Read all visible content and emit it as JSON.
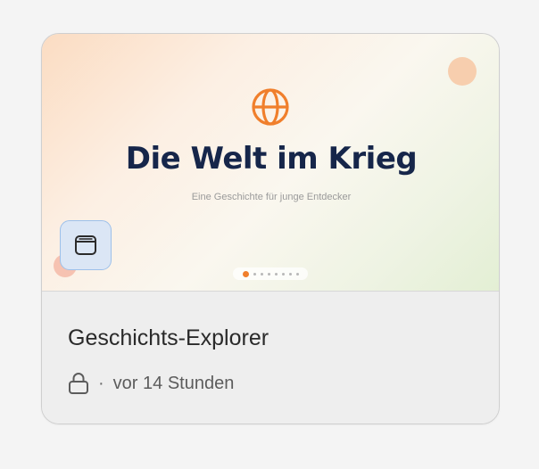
{
  "preview": {
    "title": "Die Welt im Krieg",
    "subtitle": "Eine Geschichte für junge Entdecker",
    "icon": "globe-icon",
    "app_icon": "browser-window-icon",
    "carousel": {
      "total": 8,
      "active_index": 0
    }
  },
  "project": {
    "name": "Geschichts-Explorer",
    "visibility_icon": "lock-icon",
    "separator": "·",
    "updated": "vor 14 Stunden"
  },
  "colors": {
    "accent_orange": "#f07f2c",
    "title_navy": "#16264a",
    "app_icon_bg": "#dbe6f5",
    "app_icon_border": "#9dc0ea"
  }
}
